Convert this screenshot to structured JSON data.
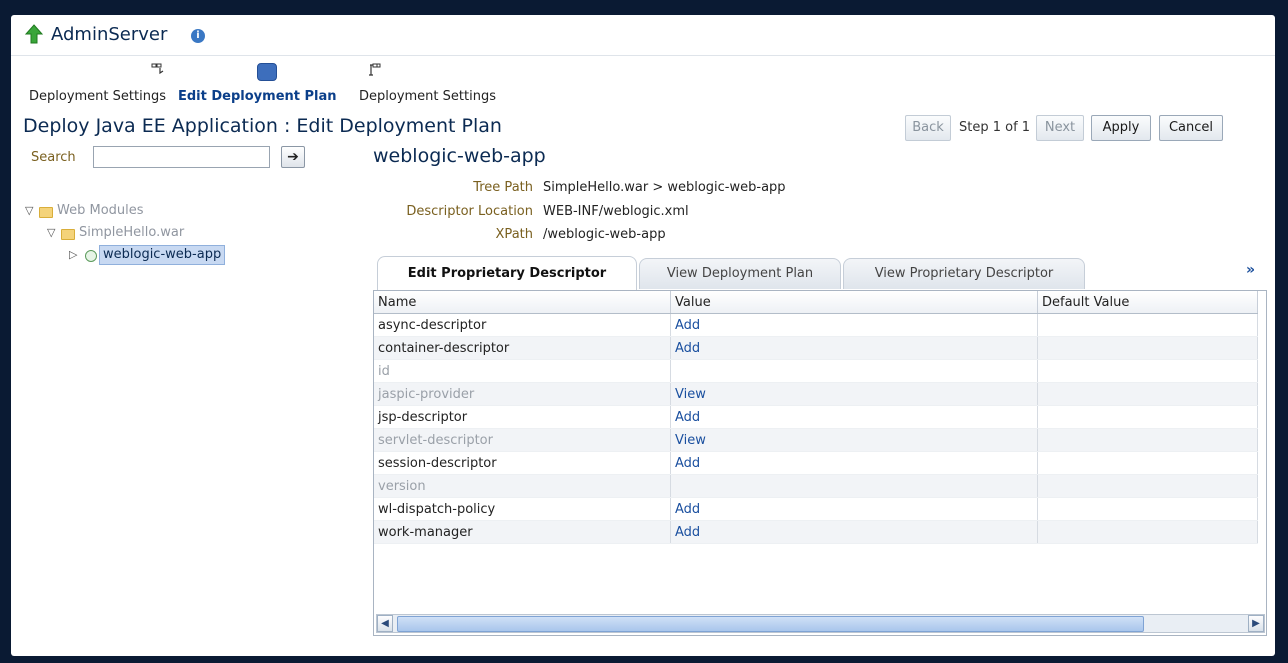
{
  "header": {
    "title": "AdminServer"
  },
  "train": {
    "steps": [
      {
        "label": "Deployment Settings"
      },
      {
        "label": "Edit Deployment Plan"
      },
      {
        "label": "Deployment Settings"
      }
    ]
  },
  "page": {
    "title": "Deploy Java EE Application : Edit Deployment Plan"
  },
  "buttons": {
    "back": "Back",
    "step": "Step 1 of 1",
    "next": "Next",
    "apply": "Apply",
    "cancel": "Cancel"
  },
  "search": {
    "label": "Search",
    "value": "",
    "go": "➔"
  },
  "tree": {
    "root": "Web Modules",
    "child": "SimpleHello.war",
    "leaf": "weblogic-web-app"
  },
  "detail": {
    "title": "weblogic-web-app",
    "tree_path_label": "Tree Path",
    "tree_path": "SimpleHello.war > weblogic-web-app",
    "descriptor_location_label": "Descriptor Location",
    "descriptor_location": "WEB-INF/weblogic.xml",
    "xpath_label": "XPath",
    "xpath": "/weblogic-web-app"
  },
  "tabs": [
    "Edit Proprietary Descriptor",
    "View Deployment Plan",
    "View Proprietary Descriptor"
  ],
  "table": {
    "headers": [
      "Name",
      "Value",
      "Default Value"
    ],
    "rows": [
      {
        "name": "async-descriptor",
        "value": "Add",
        "default": ""
      },
      {
        "name": "container-descriptor",
        "value": "Add",
        "default": ""
      },
      {
        "name": "id",
        "value": "",
        "default": ""
      },
      {
        "name": "jaspic-provider",
        "value": "View",
        "default": ""
      },
      {
        "name": "jsp-descriptor",
        "value": "Add",
        "default": ""
      },
      {
        "name": "servlet-descriptor",
        "value": "View",
        "default": ""
      },
      {
        "name": "session-descriptor",
        "value": "Add",
        "default": ""
      },
      {
        "name": "version",
        "value": "",
        "default": ""
      },
      {
        "name": "wl-dispatch-policy",
        "value": "Add",
        "default": ""
      },
      {
        "name": "work-manager",
        "value": "Add",
        "default": ""
      }
    ]
  }
}
